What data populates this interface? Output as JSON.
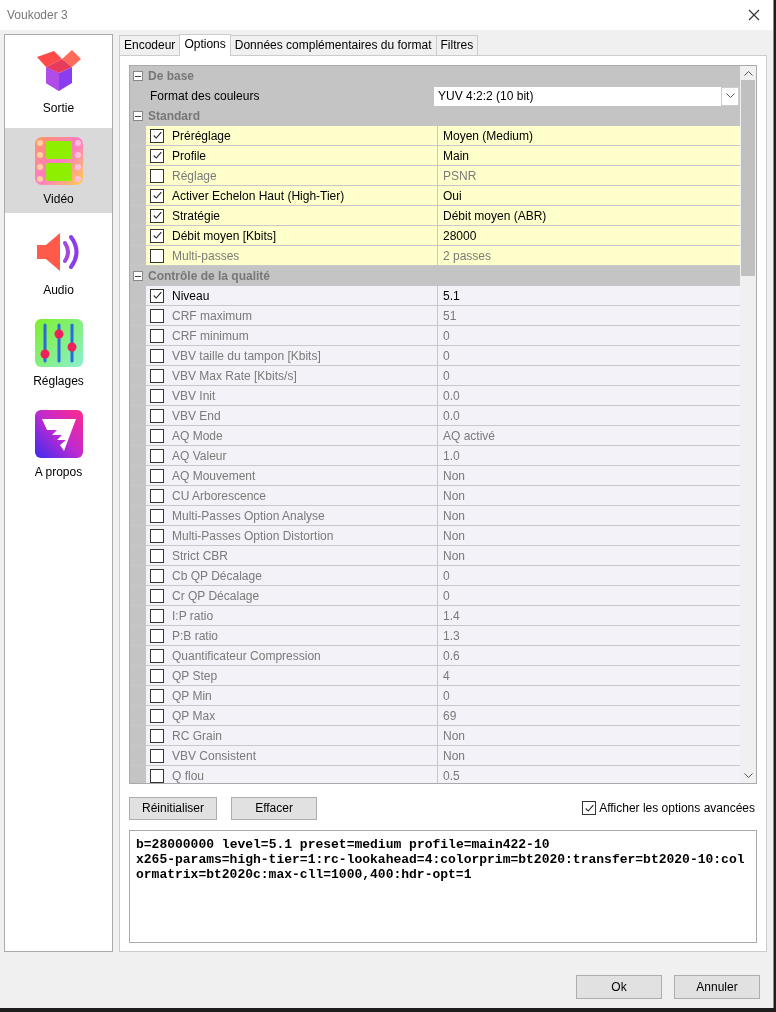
{
  "window": {
    "title": "Voukoder 3"
  },
  "sidebar": {
    "items": [
      {
        "label": "Sortie",
        "selected": false
      },
      {
        "label": "Vidéo",
        "selected": true
      },
      {
        "label": "Audio",
        "selected": false
      },
      {
        "label": "Réglages",
        "selected": false
      },
      {
        "label": "A propos",
        "selected": false
      }
    ]
  },
  "tabs": [
    {
      "label": "Encodeur",
      "selected": false
    },
    {
      "label": "Options",
      "selected": true
    },
    {
      "label": "Données complémentaires du format",
      "selected": false
    },
    {
      "label": "Filtres",
      "selected": false
    }
  ],
  "property_grid": {
    "sections": [
      {
        "title": "De base",
        "expanded": true,
        "highlighted": false,
        "rows": [
          {
            "kind": "dropdown",
            "label": "Format des couleurs",
            "value": "YUV 4:2:2 (10 bit)"
          }
        ]
      },
      {
        "title": "Standard",
        "expanded": true,
        "highlighted": true,
        "rows": [
          {
            "kind": "option",
            "label": "Préréglage",
            "value": "Moyen (Medium)",
            "checked": true
          },
          {
            "kind": "option",
            "label": "Profile",
            "value": "Main",
            "checked": true
          },
          {
            "kind": "option",
            "label": "Réglage",
            "value": "PSNR",
            "checked": false
          },
          {
            "kind": "option",
            "label": "Activer Echelon Haut (High-Tier)",
            "value": "Oui",
            "checked": true
          },
          {
            "kind": "option",
            "label": "Stratégie",
            "value": "Débit moyen (ABR)",
            "checked": true
          },
          {
            "kind": "option",
            "label": "Débit moyen [Kbits]",
            "value": "28000",
            "checked": true
          },
          {
            "kind": "option",
            "label": "Multi-passes",
            "value": "2 passes",
            "checked": false
          }
        ]
      },
      {
        "title": "Contrôle de la qualité",
        "expanded": true,
        "highlighted": false,
        "rows": [
          {
            "kind": "option",
            "label": "Niveau",
            "value": "5.1",
            "checked": true
          },
          {
            "kind": "option",
            "label": "CRF maximum",
            "value": "51",
            "checked": false
          },
          {
            "kind": "option",
            "label": "CRF minimum",
            "value": "0",
            "checked": false
          },
          {
            "kind": "option",
            "label": "VBV taille du tampon [Kbits]",
            "value": "0",
            "checked": false
          },
          {
            "kind": "option",
            "label": "VBV Max Rate [Kbits/s]",
            "value": "0",
            "checked": false
          },
          {
            "kind": "option",
            "label": "VBV Init",
            "value": "0.0",
            "checked": false
          },
          {
            "kind": "option",
            "label": "VBV End",
            "value": "0.0",
            "checked": false
          },
          {
            "kind": "option",
            "label": "AQ Mode",
            "value": "AQ activé",
            "checked": false
          },
          {
            "kind": "option",
            "label": "AQ Valeur",
            "value": "1.0",
            "checked": false
          },
          {
            "kind": "option",
            "label": "AQ Mouvement",
            "value": "Non",
            "checked": false
          },
          {
            "kind": "option",
            "label": "CU Arborescence",
            "value": "Non",
            "checked": false
          },
          {
            "kind": "option",
            "label": "Multi-Passes Option Analyse",
            "value": "Non",
            "checked": false
          },
          {
            "kind": "option",
            "label": "Multi-Passes Option Distortion",
            "value": "Non",
            "checked": false
          },
          {
            "kind": "option",
            "label": "Strict CBR",
            "value": "Non",
            "checked": false
          },
          {
            "kind": "option",
            "label": "Cb QP Décalage",
            "value": "0",
            "checked": false
          },
          {
            "kind": "option",
            "label": "Cr QP Décalage",
            "value": "0",
            "checked": false
          },
          {
            "kind": "option",
            "label": "I:P ratio",
            "value": "1.4",
            "checked": false
          },
          {
            "kind": "option",
            "label": "P:B ratio",
            "value": "1.3",
            "checked": false
          },
          {
            "kind": "option",
            "label": "Quantificateur Compression",
            "value": "0.6",
            "checked": false
          },
          {
            "kind": "option",
            "label": "QP Step",
            "value": "4",
            "checked": false
          },
          {
            "kind": "option",
            "label": "QP Min",
            "value": "0",
            "checked": false
          },
          {
            "kind": "option",
            "label": "QP Max",
            "value": "69",
            "checked": false
          },
          {
            "kind": "option",
            "label": "RC Grain",
            "value": "Non",
            "checked": false
          },
          {
            "kind": "option",
            "label": "VBV Consistent",
            "value": "Non",
            "checked": false
          },
          {
            "kind": "option",
            "label": "Q flou",
            "value": "0.5",
            "checked": false
          }
        ]
      }
    ]
  },
  "actions": [
    "Réinitialiser",
    "Effacer"
  ],
  "advanced_checkbox": {
    "label": "Afficher les options avancées",
    "checked": true
  },
  "command_line": "b=28000000 level=5.1 preset=medium profile=main422-10 x265-params=high-tier=1:rc-lookahead=4:colorprim=bt2020:transfer=bt2020-10:colormatrix=bt2020c:max-cll=1000,400:hdr-opt=1",
  "buttons": [
    "Ok",
    "Annuler"
  ]
}
